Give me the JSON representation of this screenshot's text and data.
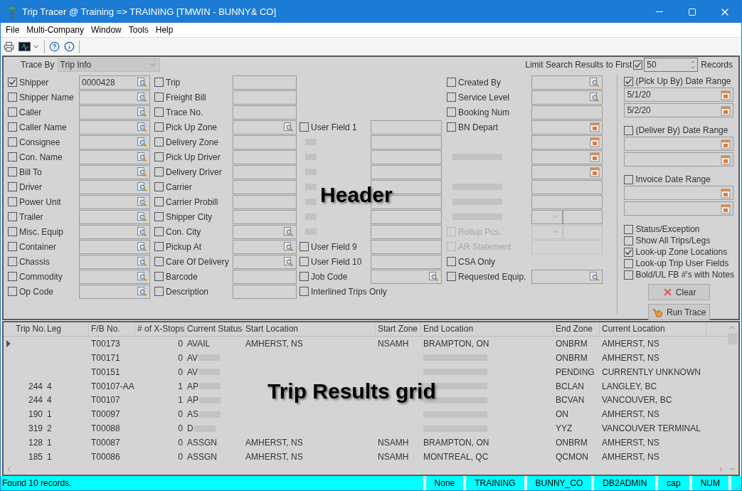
{
  "window": {
    "title": "Trip Tracer @ Training => TRAINING [TMWIN - BUNNY& CO]"
  },
  "menu": [
    "File",
    "Multi-Company",
    "Window",
    "Tools",
    "Help"
  ],
  "header": {
    "trace_by": {
      "label": "Trace By",
      "value": "Trip Info"
    },
    "limit": {
      "label": "Limit Search Results to First",
      "checked": true,
      "value": "50",
      "suffix": "Records"
    },
    "columns": [
      [
        {
          "kind": "lookup",
          "label": "Shipper",
          "checked": true,
          "value": "0000428"
        },
        {
          "kind": "lookup",
          "label": "Shipper Name",
          "checked": false
        },
        {
          "kind": "lookup",
          "label": "Caller",
          "checked": false
        },
        {
          "kind": "lookup",
          "label": "Caller Name",
          "checked": false
        },
        {
          "kind": "lookup",
          "label": "Consignee",
          "checked": false
        },
        {
          "kind": "lookup",
          "label": "Con. Name",
          "checked": false
        },
        {
          "kind": "lookup",
          "label": "Bill To",
          "checked": false
        },
        {
          "kind": "lookup",
          "label": "Driver",
          "checked": false
        },
        {
          "kind": "lookup",
          "label": "Power Unit",
          "checked": false
        },
        {
          "kind": "lookup",
          "label": "Trailer",
          "checked": false
        },
        {
          "kind": "lookup",
          "label": "Misc. Equip",
          "checked": false
        },
        {
          "kind": "lookup",
          "label": "Container",
          "checked": false
        },
        {
          "kind": "lookup",
          "label": "Chassis",
          "checked": false
        },
        {
          "kind": "lookup",
          "label": "Commodity",
          "checked": false
        },
        {
          "kind": "lookup",
          "label": "Op Code",
          "checked": false
        }
      ],
      [
        {
          "kind": "text",
          "label": "Trip",
          "checked": false
        },
        {
          "kind": "text",
          "label": "Freight Bill",
          "checked": false
        },
        {
          "kind": "text",
          "label": "Trace No.",
          "checked": false
        },
        {
          "kind": "lookup",
          "label": "Pick Up Zone",
          "checked": false
        },
        {
          "kind": "text",
          "label": "Delivery Zone",
          "checked": false
        },
        {
          "kind": "text",
          "label": "Pick Up Driver",
          "checked": false
        },
        {
          "kind": "text",
          "label": "Delivery Driver",
          "checked": false
        },
        {
          "kind": "text",
          "label": "Carrier",
          "checked": false
        },
        {
          "kind": "text",
          "label": "Carrier Probill",
          "checked": false
        },
        {
          "kind": "text",
          "label": "Shipper City",
          "checked": false
        },
        {
          "kind": "lookup",
          "label": "Con. City",
          "checked": false
        },
        {
          "kind": "lookup",
          "label": "Pickup At",
          "checked": false
        },
        {
          "kind": "lookup",
          "label": "Care Of Delivery",
          "checked": false
        },
        {
          "kind": "text",
          "label": "Barcode",
          "checked": false
        },
        {
          "kind": "text",
          "label": "Description",
          "checked": false
        }
      ],
      [
        {
          "kind": "text",
          "label": "User Field 1",
          "checked": false
        },
        {
          "kind": "redacted"
        },
        {
          "kind": "redacted"
        },
        {
          "kind": "redacted"
        },
        {
          "kind": "redacted"
        },
        {
          "kind": "redacted"
        },
        {
          "kind": "redacted"
        },
        {
          "kind": "redacted"
        },
        {
          "kind": "text",
          "label": "User Field 9",
          "checked": false
        },
        {
          "kind": "text",
          "label": "User Field 10",
          "checked": false
        },
        {
          "kind": "lookup",
          "label": "Job Code",
          "checked": false
        },
        {
          "kind": "plain",
          "label": "Interlined Trips Only",
          "checked": false
        }
      ],
      [
        {
          "kind": "lookup",
          "label": "Created By",
          "checked": false
        },
        {
          "kind": "lookup",
          "label": "Service Level",
          "checked": false
        },
        {
          "kind": "text",
          "label": "Booking Num",
          "checked": false
        },
        {
          "kind": "date",
          "label": "BN Depart",
          "checked": false
        },
        {
          "kind": "date"
        },
        {
          "kind": "redacted_date"
        },
        {
          "kind": "date"
        },
        {
          "kind": "redacted_text"
        },
        {
          "kind": "redacted_text"
        },
        {
          "kind": "redacted_combo"
        },
        {
          "kind": "combo",
          "label": "Rollup Pcs.",
          "checked": false,
          "disabled": true
        },
        {
          "kind": "text",
          "label": "AR Statement",
          "checked": false,
          "disabled": true
        },
        {
          "kind": "plain",
          "label": "CSA Only",
          "checked": false
        },
        {
          "kind": "lookup",
          "label": "Requested Equip.",
          "checked": false
        }
      ]
    ],
    "date_ranges": [
      {
        "label": "(Pick Up By) Date Range",
        "checked": true,
        "from": "5/1/20",
        "to": "5/2/20"
      },
      {
        "label": "(Deliver By) Date Range",
        "checked": false
      },
      {
        "label": "Invoice Date Range",
        "checked": false
      }
    ],
    "options": [
      {
        "label": "Status/Exception",
        "checked": false
      },
      {
        "label": "Show All Trips/Legs",
        "checked": false
      },
      {
        "label": "Look-up Zone Locations",
        "checked": true
      },
      {
        "label": "Look-up Trip User Fields",
        "checked": false
      },
      {
        "label": "Bold/UL FB #'s with Notes",
        "checked": false
      }
    ],
    "buttons": [
      {
        "kind": "clear",
        "label": "Clear"
      },
      {
        "kind": "run",
        "label": "Run Trace"
      }
    ]
  },
  "grid": {
    "columns": [
      "Trip No.",
      "Leg",
      "F/B No.",
      "# of X-Stops",
      "Current Status",
      "Start Location",
      "Start Zone",
      "End Location",
      "End Zone",
      "Current Location"
    ],
    "rows": [
      {
        "selected": true,
        "cells": [
          null,
          null,
          "T00173",
          "0",
          "AVAIL",
          "AMHERST, NS",
          "NSAMH",
          "BRAMPTON, ON",
          "ONBRM",
          "AMHERST, NS"
        ],
        "blurred": false
      },
      {
        "selected": false,
        "cells": [
          null,
          null,
          "T00171",
          "0",
          "AV",
          null,
          null,
          null,
          "ONBRM",
          "AMHERST, NS"
        ],
        "blurred": true
      },
      {
        "selected": false,
        "cells": [
          null,
          null,
          "T00151",
          "0",
          "AV",
          null,
          null,
          null,
          "PENDING",
          "CURRENTLY UNKNOWN"
        ],
        "blurred": true
      },
      {
        "selected": false,
        "cells": [
          "244",
          "4",
          "T00107-AA",
          "1",
          "AP",
          null,
          null,
          null,
          "BCLAN",
          "LANGLEY, BC"
        ],
        "blurred": true
      },
      {
        "selected": false,
        "cells": [
          "244",
          "4",
          "T00107",
          "1",
          "AP",
          null,
          null,
          null,
          "BCVAN",
          "VANCOUVER, BC"
        ],
        "blurred": true
      },
      {
        "selected": false,
        "cells": [
          "190",
          "1",
          "T00097",
          "0",
          "AS",
          null,
          null,
          null,
          "ON",
          "AMHERST, NS"
        ],
        "blurred": true
      },
      {
        "selected": false,
        "cells": [
          "319",
          "2",
          "T00088",
          "0",
          "D",
          null,
          null,
          null,
          "YYZ",
          "VANCOUVER TERMINAL"
        ],
        "blurred": true
      },
      {
        "selected": false,
        "cells": [
          "128",
          "1",
          "T00087",
          "0",
          "ASSGN",
          "AMHERST, NS",
          "NSAMH",
          "BRAMPTON, ON",
          "ONBRM",
          "AMHERST, NS"
        ],
        "blurred": false
      },
      {
        "selected": false,
        "cells": [
          "185",
          "1",
          "T00086",
          "0",
          "ASSGN",
          "AMHERST, NS",
          "NSAMH",
          "MONTREAL, QC",
          "QCMON",
          "AMHERST, NS"
        ],
        "blurred": false
      }
    ]
  },
  "annotations": [
    {
      "kind": "header",
      "text": "Header"
    },
    {
      "kind": "grid",
      "text": "Trip Results grid"
    }
  ],
  "status_bar": {
    "message": "Found 10 records.",
    "panels": [
      "None",
      "TRAINING",
      "BUNNY_CO",
      "DB2ADMIN",
      "cap",
      "NUM"
    ]
  }
}
